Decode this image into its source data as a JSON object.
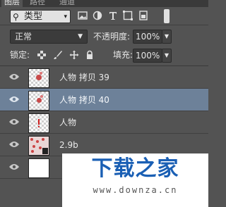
{
  "tabs": [
    "图层",
    "路径",
    "通道"
  ],
  "filter": {
    "label": "类型",
    "icons": [
      "image-filter-icon",
      "adjustment-filter-icon",
      "type-filter-icon",
      "shape-filter-icon",
      "smart-object-filter-icon"
    ]
  },
  "blend": {
    "mode": "正常",
    "opacity_label": "不透明度:",
    "opacity_value": "100%"
  },
  "lock": {
    "label": "锁定:",
    "icons": [
      "lock-pixels-icon",
      "lock-image-icon",
      "lock-position-icon",
      "lock-all-icon"
    ]
  },
  "fill": {
    "label": "填充:",
    "value": "100%"
  },
  "layers": [
    {
      "name": "人物 拷贝 39",
      "selected": false,
      "thumb": "figure-small"
    },
    {
      "name": "人物 拷贝 40",
      "selected": true,
      "thumb": "figure-small"
    },
    {
      "name": "人物",
      "selected": false,
      "thumb": "figure-red-mark"
    },
    {
      "name": "2.9b",
      "selected": false,
      "thumb": "pattern"
    },
    {
      "name": "",
      "selected": false,
      "thumb": "white"
    }
  ],
  "watermark": {
    "title": "下载之家",
    "url": "www.downza.cn"
  },
  "colors": {
    "panel": "#535353",
    "selected_row": "#6d8199",
    "watermark_blue": "#1a5fb4"
  }
}
